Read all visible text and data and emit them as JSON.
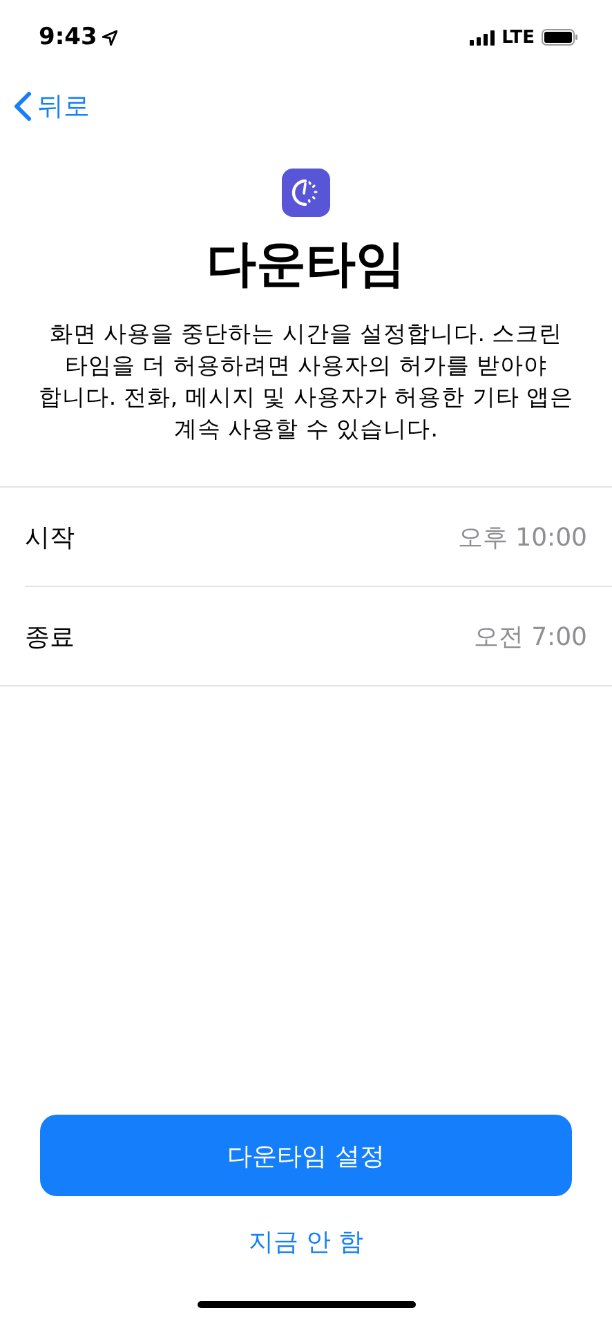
{
  "status_bar": {
    "time": "9:43",
    "network": "LTE"
  },
  "nav": {
    "back": "뒤로"
  },
  "title": "다운타임",
  "description": "화면 사용을 중단하는 시간을 설정합니다. 스크린 타임을 더 허용하려면 사용자의 허가를 받아야 합니다. 전화, 메시지 및 사용자가 허용한 기타 앱은 계속 사용할 수 있습니다.",
  "rows": [
    {
      "label": "시작",
      "value": "오후 10:00"
    },
    {
      "label": "종료",
      "value": "오전 7:00"
    }
  ],
  "primary_button": "다운타임 설정",
  "secondary_button": "지금 안 함"
}
